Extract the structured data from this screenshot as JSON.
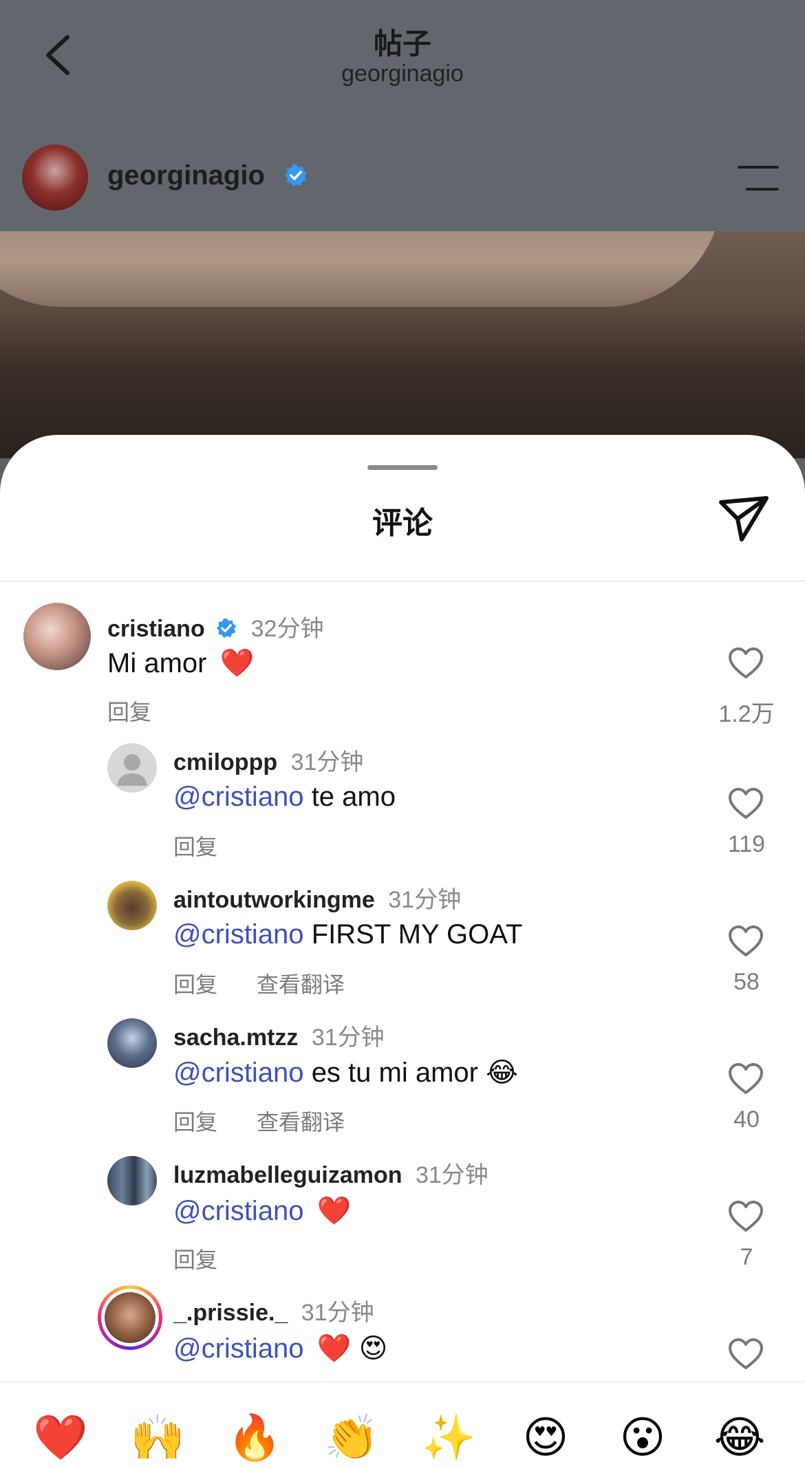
{
  "header": {
    "title": "帖子",
    "subtitle": "georginagio"
  },
  "post": {
    "username": "georginagio",
    "verified": true
  },
  "sheet": {
    "title": "评论"
  },
  "comments": [
    {
      "username": "cristiano",
      "verified": true,
      "time": "32分钟",
      "text": "Mi amor",
      "emojis": [
        "❤️"
      ],
      "actions": [
        "回复"
      ],
      "likes": "1.2万"
    },
    {
      "username": "cmiloppp",
      "time": "31分钟",
      "mention": "@cristiano",
      "text": "te amo",
      "actions": [
        "回复"
      ],
      "likes": "119"
    },
    {
      "username": "aintoutworkingme",
      "time": "31分钟",
      "mention": "@cristiano",
      "text": "FIRST MY GOAT",
      "actions": [
        "回复",
        "查看翻译"
      ],
      "likes": "58"
    },
    {
      "username": "sacha.mtzz",
      "time": "31分钟",
      "mention": "@cristiano",
      "text": "es tu mi amor",
      "emojis": [
        "😂"
      ],
      "actions": [
        "回复",
        "查看翻译"
      ],
      "likes": "40"
    },
    {
      "username": "luzmabelleguizamon",
      "time": "31分钟",
      "mention": "@cristiano",
      "text": "",
      "emojis": [
        "❤️"
      ],
      "actions": [
        "回复"
      ],
      "likes": "7"
    },
    {
      "username": "_.prissie._",
      "time": "31分钟",
      "mention": "@cristiano",
      "text": "",
      "emojis": [
        "❤️",
        "😍"
      ],
      "actions": [],
      "likes": ""
    }
  ],
  "quick_reactions": [
    "❤️",
    "🙌",
    "🔥",
    "👏",
    "✨",
    "😍",
    "😮",
    "😂"
  ],
  "colors": {
    "mention": "#3f52b8",
    "verified": "#3897f0",
    "muted": "#7c7c7c"
  }
}
